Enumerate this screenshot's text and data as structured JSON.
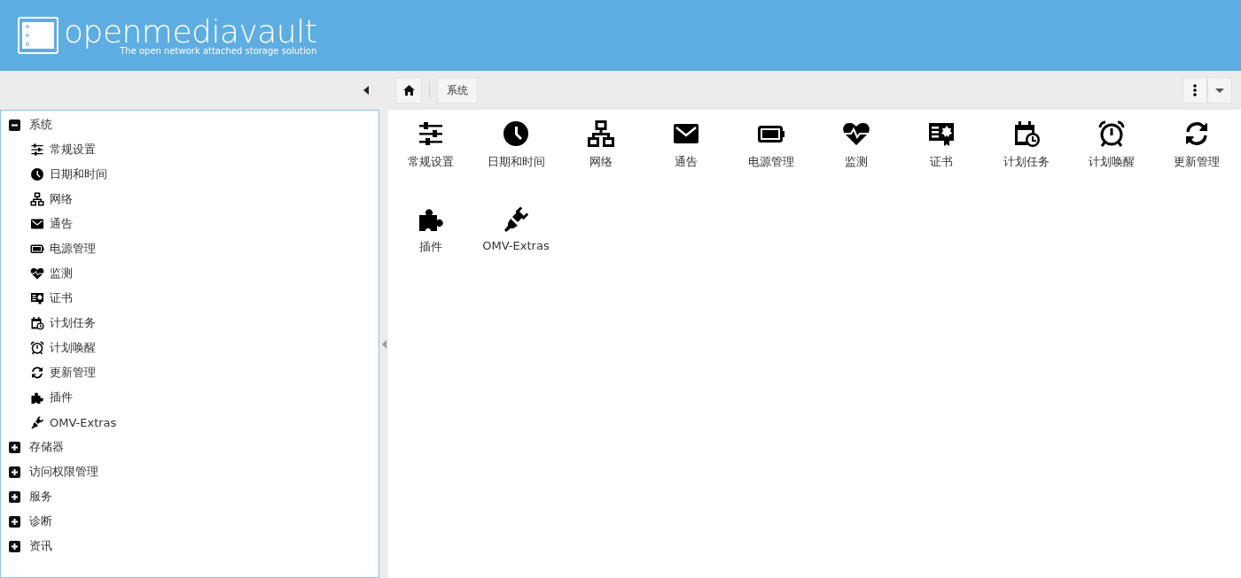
{
  "header": {
    "logo": "openmediavault",
    "tagline": "The open network attached storage solution"
  },
  "breadcrumb": [
    "系统"
  ],
  "tree": [
    {
      "label": "系统",
      "expanded": true,
      "children": [
        {
          "label": "常规设置"
        },
        {
          "label": "日期和时间"
        },
        {
          "label": "网络"
        },
        {
          "label": "通告"
        },
        {
          "label": "电源管理"
        },
        {
          "label": "监测"
        },
        {
          "label": "证书"
        },
        {
          "label": "计划任务"
        },
        {
          "label": "计划唤醒"
        },
        {
          "label": "更新管理"
        },
        {
          "label": "插件"
        },
        {
          "label": "OMV-Extras"
        }
      ]
    },
    {
      "label": "存储器",
      "expanded": false
    },
    {
      "label": "访问权限管理",
      "expanded": false
    },
    {
      "label": "服务",
      "expanded": false
    },
    {
      "label": "诊断",
      "expanded": false
    },
    {
      "label": "资讯",
      "expanded": false
    }
  ],
  "tiles": [
    {
      "label": "常规设置"
    },
    {
      "label": "日期和时间"
    },
    {
      "label": "网络"
    },
    {
      "label": "通告"
    },
    {
      "label": "电源管理"
    },
    {
      "label": "监测"
    },
    {
      "label": "证书"
    },
    {
      "label": "计划任务"
    },
    {
      "label": "计划唤醒"
    },
    {
      "label": "更新管理"
    },
    {
      "label": "插件"
    },
    {
      "label": "OMV-Extras"
    }
  ]
}
